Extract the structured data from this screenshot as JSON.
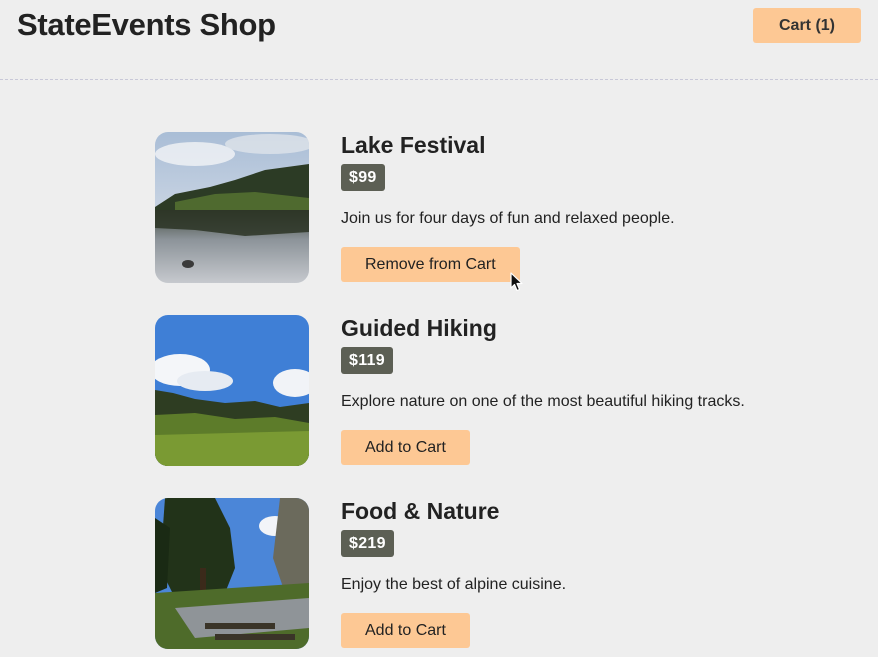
{
  "header": {
    "title": "StateEvents Shop",
    "cart_label": "Cart (1)"
  },
  "products": [
    {
      "title": "Lake Festival",
      "price": "$99",
      "description": "Join us for four days of fun and relaxed people.",
      "action_label": "Remove from Cart"
    },
    {
      "title": "Guided Hiking",
      "price": "$119",
      "description": "Explore nature on one of the most beautiful hiking tracks.",
      "action_label": "Add to Cart"
    },
    {
      "title": "Food & Nature",
      "price": "$219",
      "description": "Enjoy the best of alpine cuisine.",
      "action_label": "Add to Cart"
    }
  ],
  "colors": {
    "accent": "#fdc894",
    "price_badge": "#5c5f54",
    "background": "#eeeeee"
  },
  "icons": {
    "cursor": "mouse-pointer-icon"
  }
}
